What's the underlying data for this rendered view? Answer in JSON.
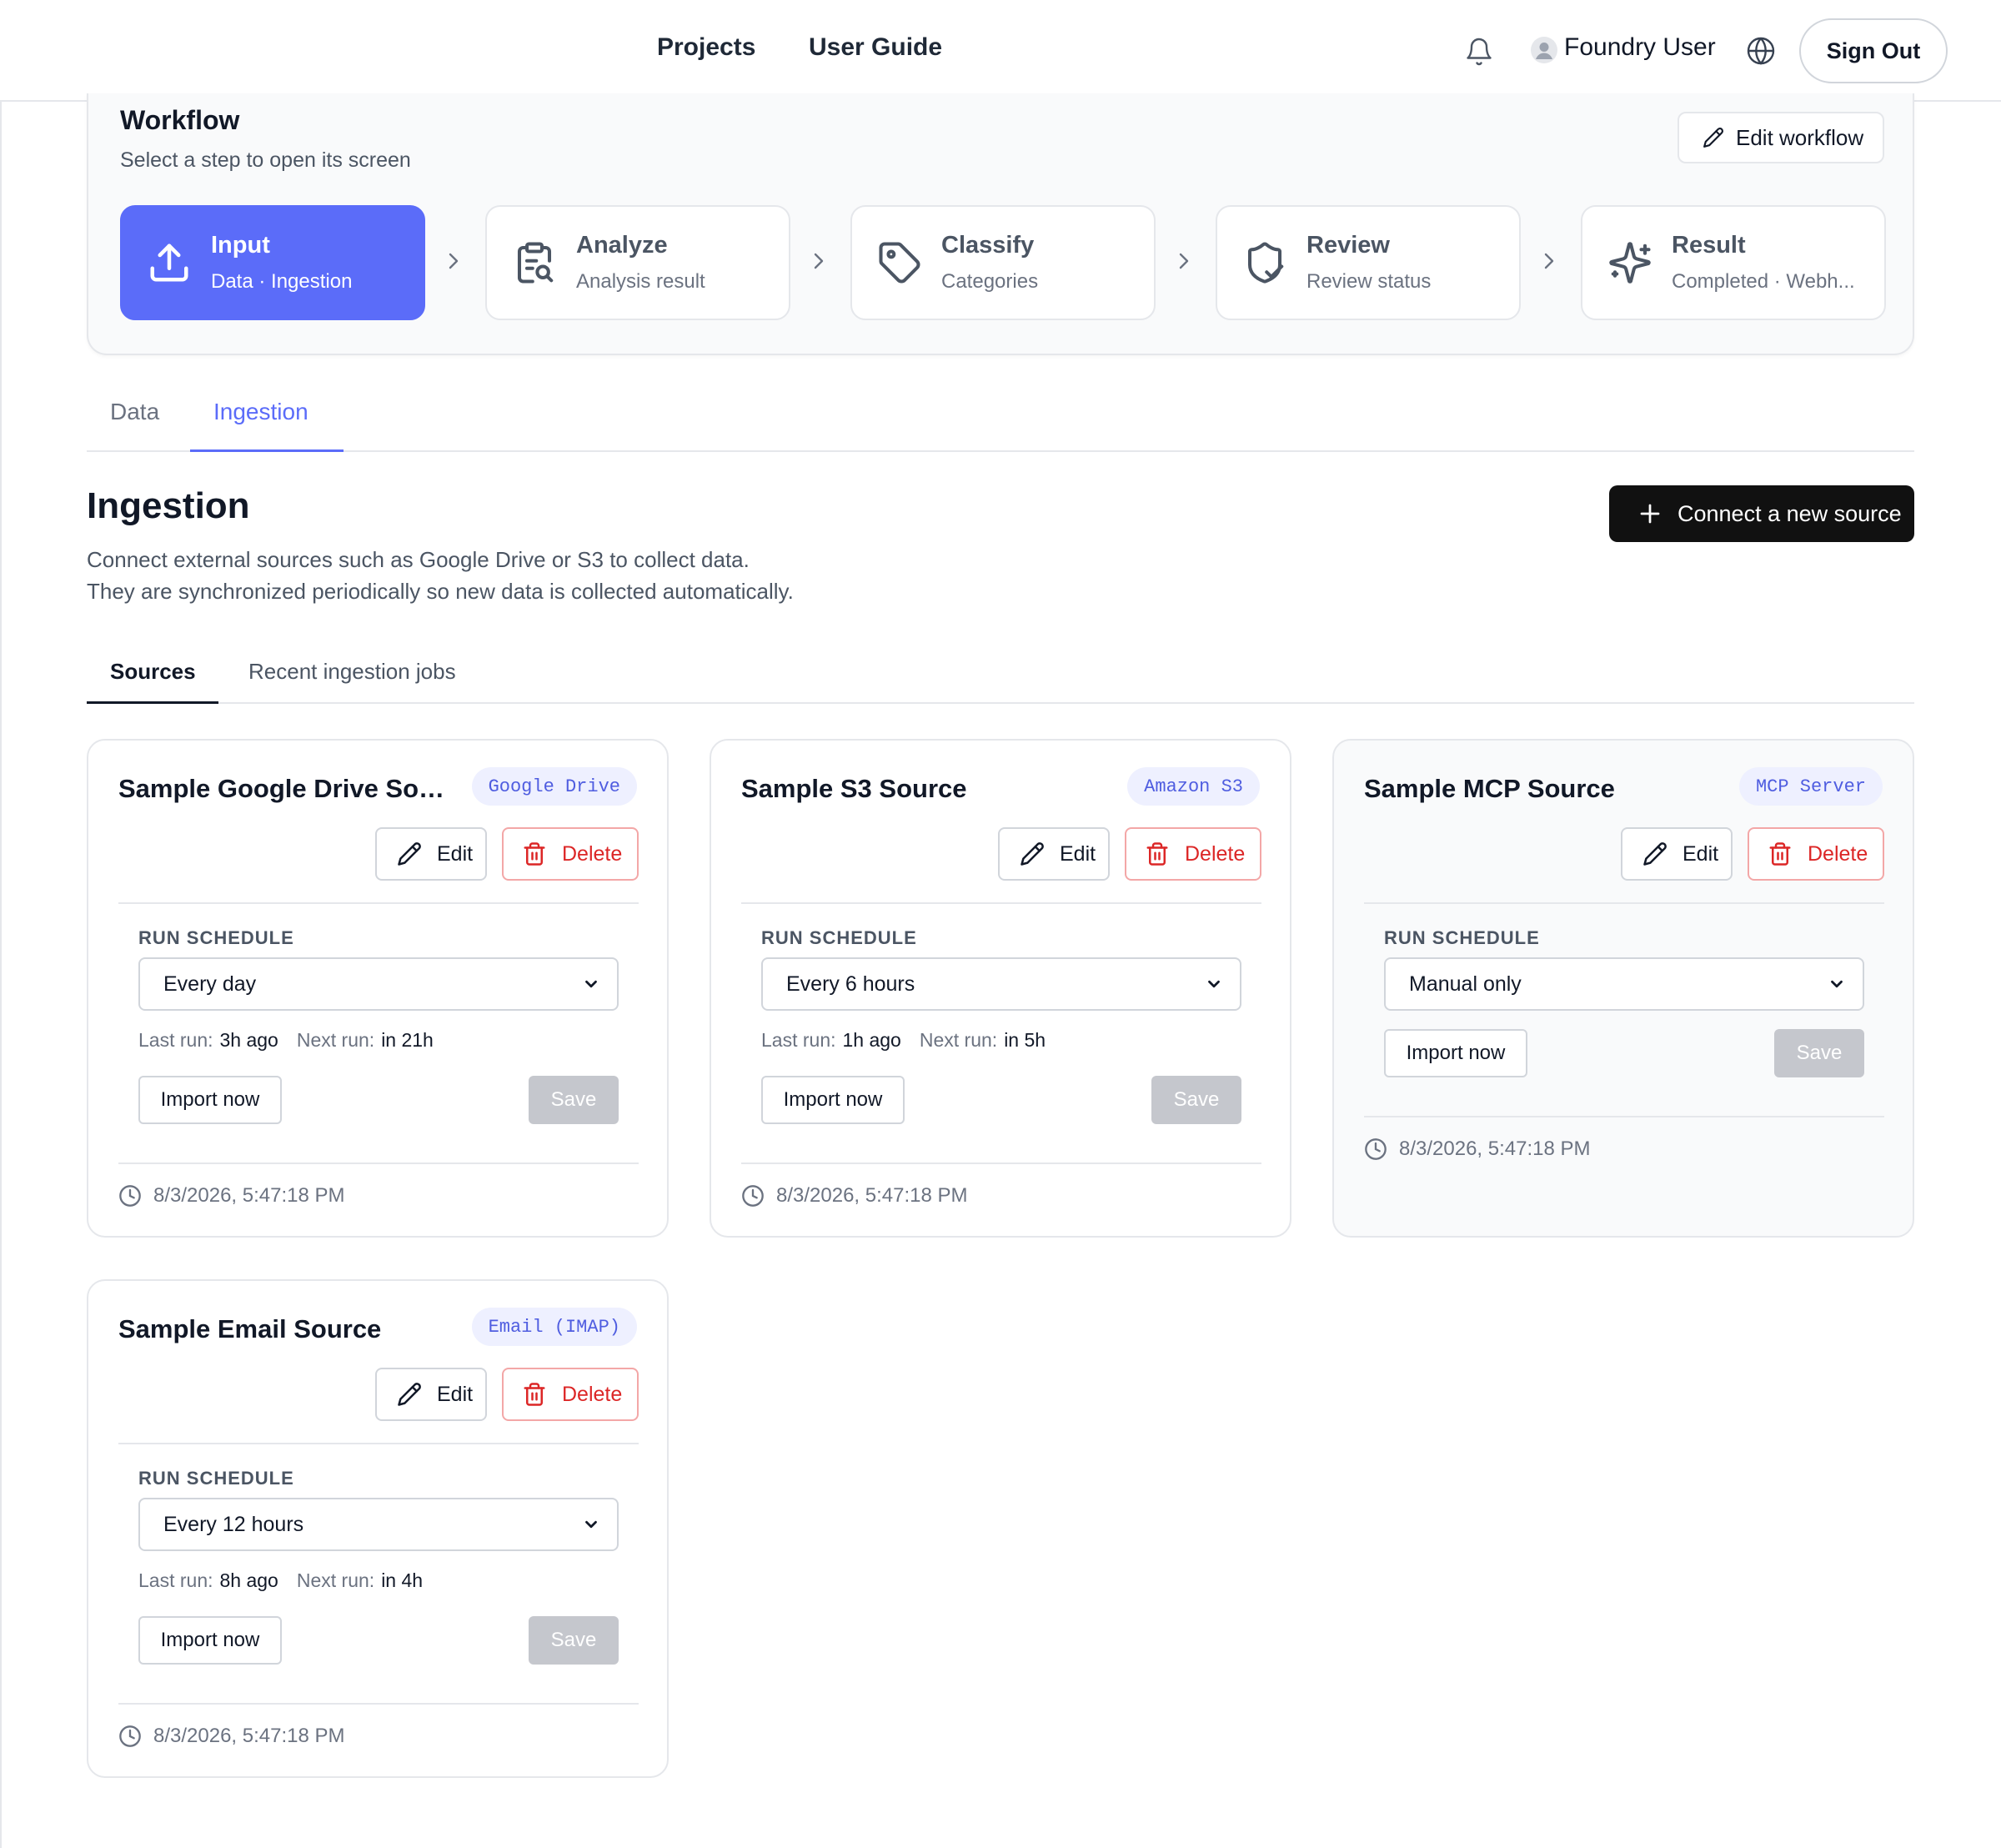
{
  "nav": {
    "links": [
      "Projects",
      "User Guide"
    ],
    "user_name": "Foundry User",
    "sign_out_label": "Sign Out",
    "icons": [
      "bell-icon",
      "user-avatar-icon",
      "globe-icon"
    ]
  },
  "workflow": {
    "title": "Workflow",
    "subtitle": "Select a step to open its screen",
    "edit_label": "Edit workflow",
    "steps": [
      {
        "title": "Input",
        "subtitle": "Data · Ingestion",
        "icon": "upload-icon",
        "active": true
      },
      {
        "title": "Analyze",
        "subtitle": "Analysis result",
        "icon": "clipboard-search-icon",
        "active": false
      },
      {
        "title": "Classify",
        "subtitle": "Categories",
        "icon": "tag-icon",
        "active": false
      },
      {
        "title": "Review",
        "subtitle": "Review status",
        "icon": "shield-check-icon",
        "active": false
      },
      {
        "title": "Result",
        "subtitle": "Completed · Webh...",
        "icon": "sparkles-icon",
        "active": false
      }
    ]
  },
  "tabs": {
    "items": [
      "Data",
      "Ingestion"
    ],
    "active": "Ingestion"
  },
  "ingestion": {
    "title": "Ingestion",
    "description_lines": [
      "Connect external sources such as Google Drive or S3 to collect data.",
      "They are synchronized periodically so new data is collected automatically."
    ],
    "connect_label": "Connect a new source",
    "subtabs": [
      "Sources",
      "Recent ingestion jobs"
    ],
    "active_subtab": "Sources"
  },
  "colors": {
    "accent": "#5b6cf9",
    "danger": "#dc2626",
    "badge_bg": "#eef0ff",
    "primary_dark": "#111111",
    "save_disabled": "#c5c7cd"
  },
  "labels": {
    "edit": "Edit",
    "delete": "Delete",
    "run_schedule": "RUN SCHEDULE",
    "last_run": "Last run:",
    "next_run": "Next run:",
    "import_now": "Import now",
    "save": "Save"
  },
  "sources": [
    {
      "name": "Sample Google Drive Sou...",
      "type": "Google Drive",
      "schedule": "Every day",
      "last_run": "3h ago",
      "next_run": "in 21h",
      "timestamp": "8/3/2026, 5:47:18 PM"
    },
    {
      "name": "Sample S3 Source",
      "type": "Amazon S3",
      "schedule": "Every 6 hours",
      "last_run": "1h ago",
      "next_run": "in 5h",
      "timestamp": "8/3/2026, 5:47:18 PM"
    },
    {
      "name": "Sample MCP Source",
      "type": "MCP Server",
      "schedule": "Manual only",
      "last_run": "",
      "next_run": "",
      "timestamp": "8/3/2026, 5:47:18 PM"
    },
    {
      "name": "Sample Email Source",
      "type": "Email (IMAP)",
      "schedule": "Every 12 hours",
      "last_run": "8h ago",
      "next_run": "in 4h",
      "timestamp": "8/3/2026, 5:47:18 PM"
    }
  ]
}
